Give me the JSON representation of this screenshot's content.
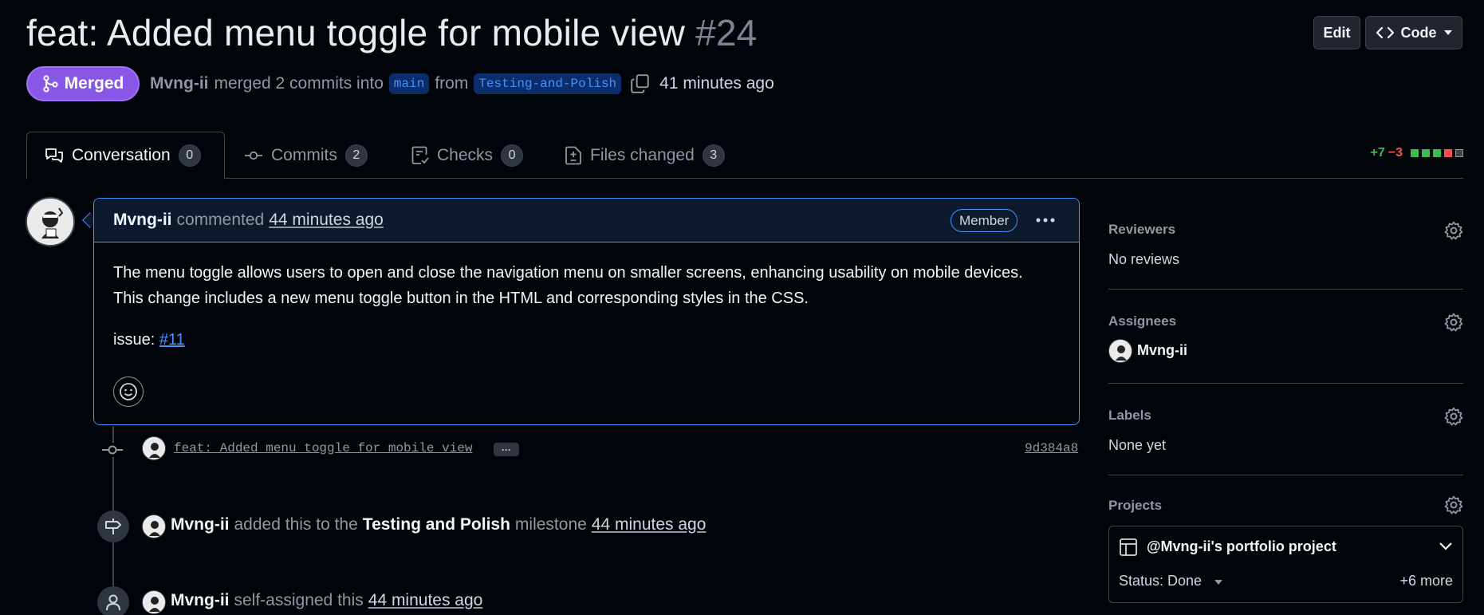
{
  "header": {
    "title": "feat: Added menu toggle for mobile view",
    "number": "#24",
    "edit_label": "Edit",
    "code_label": "Code"
  },
  "status": {
    "badge": "Merged",
    "author": "Mvng-ii",
    "merged_text": "merged 2 commits into",
    "base_branch": "main",
    "from_text": "from",
    "head_branch": "Testing-and-Polish",
    "time": "41 minutes ago"
  },
  "tabs": [
    {
      "label": "Conversation",
      "count": "0"
    },
    {
      "label": "Commits",
      "count": "2"
    },
    {
      "label": "Checks",
      "count": "0"
    },
    {
      "label": "Files changed",
      "count": "3"
    }
  ],
  "diffstat": {
    "additions": "+7",
    "deletions": "−3",
    "colors": {
      "add": "#3fb950",
      "del": "#f85149",
      "neutral": "#3d444d"
    }
  },
  "comment": {
    "author": "Mvng-ii",
    "action": "commented",
    "time": "44 minutes ago",
    "role": "Member",
    "body": "The menu toggle allows users to open and close the navigation menu on smaller screens, enhancing usability on mobile devices. This change includes a new menu toggle button in the HTML and corresponding styles in the CSS.",
    "issue_label": "issue:",
    "issue_link": "#11"
  },
  "timeline": {
    "commit": {
      "message": "feat: Added menu toggle for mobile view",
      "more": "···",
      "sha": "9d384a8"
    },
    "milestone_event": {
      "actor": "Mvng-ii",
      "text_before": "added this to the",
      "milestone": "Testing and Polish",
      "text_after": "milestone",
      "time": "44 minutes ago"
    },
    "assign_event": {
      "actor": "Mvng-ii",
      "text": "self-assigned this",
      "time": "44 minutes ago"
    }
  },
  "sidebar": {
    "reviewers": {
      "title": "Reviewers",
      "value": "No reviews"
    },
    "assignees": {
      "title": "Assignees",
      "value": "Mvng-ii"
    },
    "labels": {
      "title": "Labels",
      "value": "None yet"
    },
    "projects": {
      "title": "Projects",
      "project_name": "@Mvng-ii's portfolio project",
      "status": "Status: Done",
      "more": "+6 more"
    }
  },
  "colors": {
    "accent": "#4493f8",
    "merged": "#8957e5",
    "background": "#010409"
  }
}
